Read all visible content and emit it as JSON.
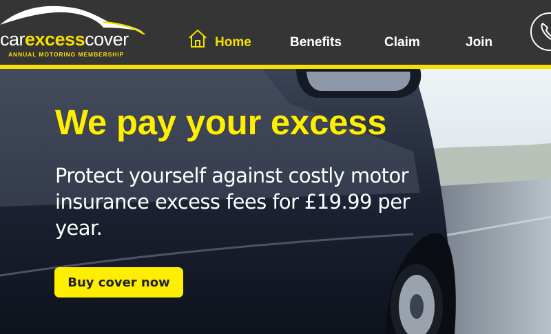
{
  "brand": {
    "logo_car": "car",
    "logo_excess": "excess",
    "logo_cover": "cover",
    "tagline": "ANNUAL MOTORING MEMBERSHIP"
  },
  "nav": {
    "items": [
      {
        "label": "Home",
        "active": true,
        "icon": "home-icon"
      },
      {
        "label": "Benefits",
        "active": false
      },
      {
        "label": "Claim",
        "active": false
      },
      {
        "label": "Join",
        "active": false
      }
    ],
    "phone_icon": "phone-icon"
  },
  "hero": {
    "title": "We pay your excess",
    "subtitle": "Protect yourself against costly motor insurance excess fees for £19.99 per year.",
    "cta_label": "Buy cover now"
  },
  "colors": {
    "accent": "#ffee00",
    "header_bg": "#353535",
    "text_light": "#ffffff"
  }
}
